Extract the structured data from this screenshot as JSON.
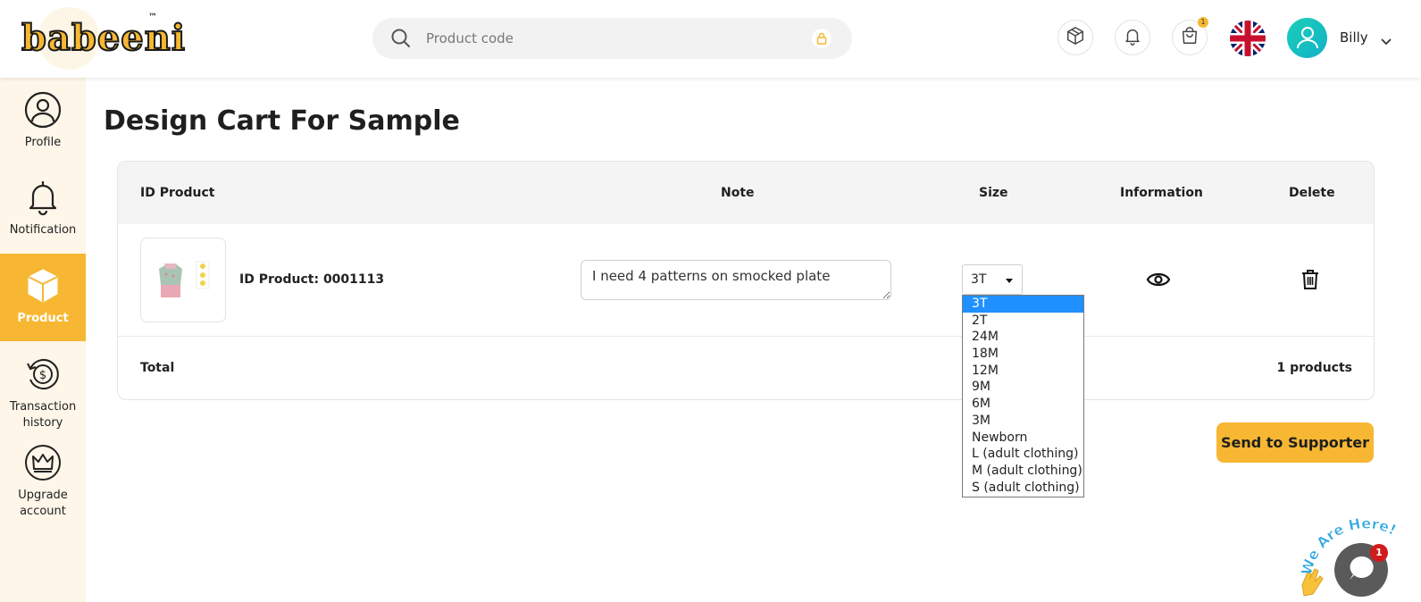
{
  "header": {
    "logo_text": "babeeni",
    "logo_tm": "™",
    "search_placeholder": "Product code",
    "cart_count": "1",
    "user_name": "Billy"
  },
  "sidebar": {
    "items": [
      {
        "label": "Profile",
        "icon": "user-circle-icon"
      },
      {
        "label": "Notification",
        "icon": "bell-icon"
      },
      {
        "label": "Product",
        "icon": "box-icon",
        "active": true
      },
      {
        "label": "Transaction history",
        "icon": "dollar-history-icon"
      },
      {
        "label": "Upgrade account",
        "icon": "crown-icon"
      }
    ]
  },
  "main": {
    "title": "Design Cart For Sample",
    "table": {
      "headers": {
        "id_product": "ID Product",
        "note": "Note",
        "size": "Size",
        "information": "Information",
        "delete": "Delete"
      },
      "rows": [
        {
          "id_product_label": "ID Product: 0001113",
          "note": "I need 4 patterns on smocked plate",
          "size": "3T"
        }
      ],
      "total_label": "Total",
      "total_count": "1 products"
    },
    "size_options": [
      "3T",
      "2T",
      "24M",
      "18M",
      "12M",
      "9M",
      "6M",
      "3M",
      "Newborn",
      "L (adult clothing)",
      "M (adult clothing)",
      "S (adult clothing)"
    ],
    "send_button": "Send to Supporter"
  },
  "chat": {
    "banner": "We Are Here!",
    "badge": "1"
  },
  "colors": {
    "accent": "#f7b733",
    "sidebar_bg": "#fdf6e9",
    "dropdown_selected": "#1e90ff"
  }
}
